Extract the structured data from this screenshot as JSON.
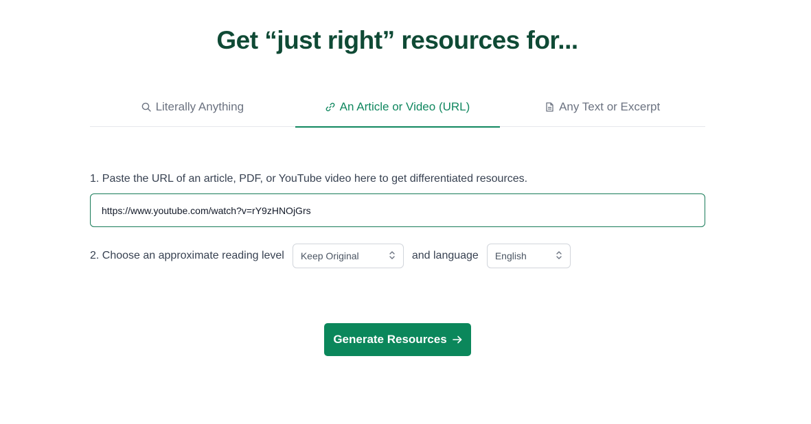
{
  "headline": "Get “just right” resources for...",
  "tabs": [
    {
      "label": "Literally Anything",
      "icon": "search-icon",
      "active": false
    },
    {
      "label": "An Article or Video (URL)",
      "icon": "link-icon",
      "active": true
    },
    {
      "label": "Any Text or Excerpt",
      "icon": "document-icon",
      "active": false
    }
  ],
  "form": {
    "step1_label": "1. Paste the URL of an article, PDF, or YouTube video here to get differentiated resources.",
    "url_value": "https://www.youtube.com/watch?v=rY9zHNOjGrs",
    "step2_label": "2. Choose an approximate reading level",
    "reading_level": "Keep Original",
    "language_label": "and language",
    "language": "English"
  },
  "generate_button": {
    "label": "Generate Resources"
  },
  "colors": {
    "accent": "#10875f",
    "headline": "#0f4a35",
    "button": "#0b875b"
  }
}
